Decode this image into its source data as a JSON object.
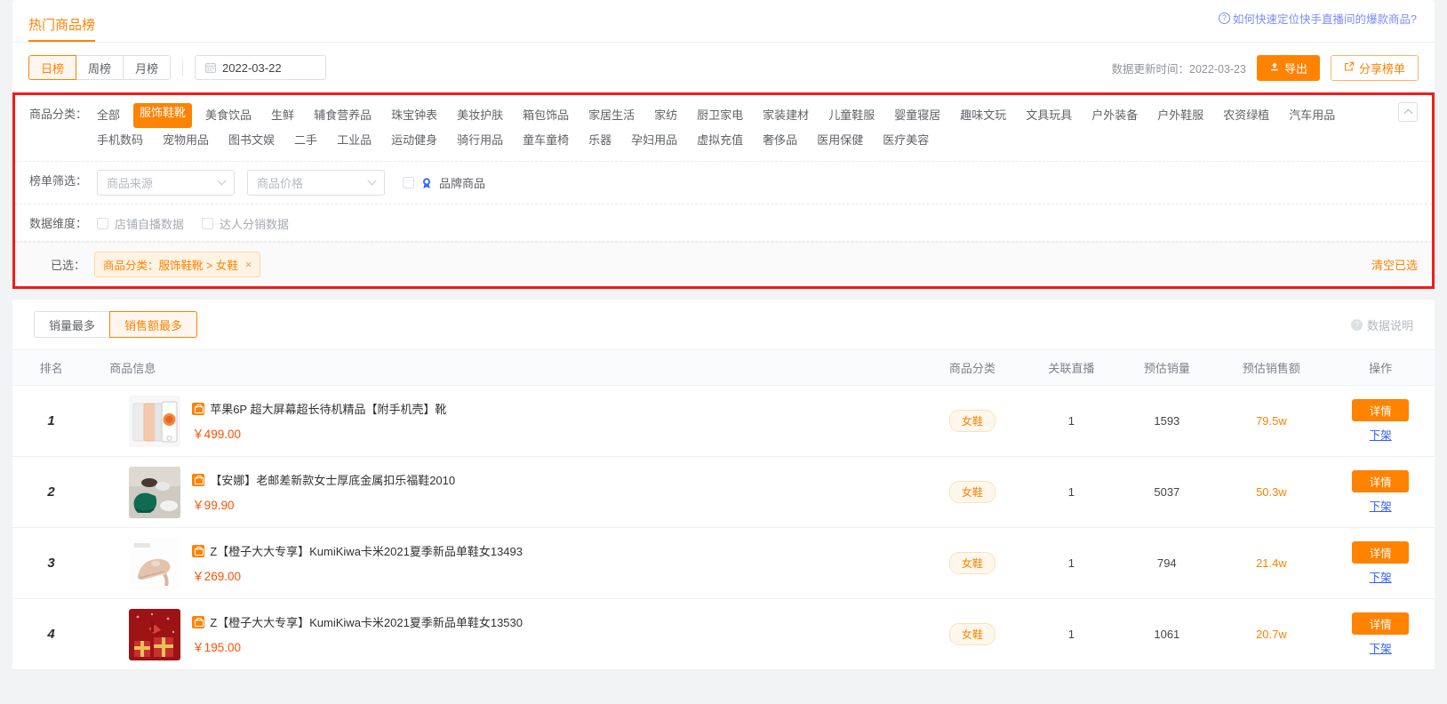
{
  "header": {
    "page_title": "热门商品榜",
    "help_link": "如何快速定位快手直播间的爆款商品?",
    "help_icon": "question-circle-icon"
  },
  "controls": {
    "period_tabs": [
      {
        "label": "日榜",
        "active": true
      },
      {
        "label": "周榜",
        "active": false
      },
      {
        "label": "月榜",
        "active": false
      }
    ],
    "date_value": "2022-03-22",
    "update_time_label": "数据更新时间：2022-03-23",
    "export_label": "导出",
    "share_label": "分享榜单"
  },
  "filters": {
    "category_label": "商品分类：",
    "categories": [
      {
        "label": "全部",
        "active": false
      },
      {
        "label": "服饰鞋靴",
        "active": true
      },
      {
        "label": "美食饮品",
        "active": false
      },
      {
        "label": "生鲜",
        "active": false
      },
      {
        "label": "辅食营养品",
        "active": false
      },
      {
        "label": "珠宝钟表",
        "active": false
      },
      {
        "label": "美妆护肤",
        "active": false
      },
      {
        "label": "箱包饰品",
        "active": false
      },
      {
        "label": "家居生活",
        "active": false
      },
      {
        "label": "家纺",
        "active": false
      },
      {
        "label": "厨卫家电",
        "active": false
      },
      {
        "label": "家装建材",
        "active": false
      },
      {
        "label": "儿童鞋服",
        "active": false
      },
      {
        "label": "婴童寝居",
        "active": false
      },
      {
        "label": "趣味文玩",
        "active": false
      },
      {
        "label": "文具玩具",
        "active": false
      },
      {
        "label": "户外装备",
        "active": false
      },
      {
        "label": "户外鞋服",
        "active": false
      },
      {
        "label": "农资绿植",
        "active": false
      },
      {
        "label": "汽车用品",
        "active": false
      },
      {
        "label": "手机数码",
        "active": false
      },
      {
        "label": "宠物用品",
        "active": false
      },
      {
        "label": "图书文娱",
        "active": false
      },
      {
        "label": "二手",
        "active": false
      },
      {
        "label": "工业品",
        "active": false
      },
      {
        "label": "运动健身",
        "active": false
      },
      {
        "label": "骑行用品",
        "active": false
      },
      {
        "label": "童车童椅",
        "active": false
      },
      {
        "label": "乐器",
        "active": false
      },
      {
        "label": "孕妇用品",
        "active": false
      },
      {
        "label": "虚拟充值",
        "active": false
      },
      {
        "label": "奢侈品",
        "active": false
      },
      {
        "label": "医用保健",
        "active": false
      },
      {
        "label": "医疗美容",
        "active": false
      }
    ],
    "collapse_icon": "chevron-up-icon",
    "list_filter_label": "榜单筛选：",
    "source_select_placeholder": "商品来源",
    "price_select_placeholder": "商品价格",
    "brand_checkbox_label": "品牌商品",
    "brand_icon": "brand-badge-icon",
    "dimension_label": "数据维度：",
    "dimension_options": [
      {
        "label": "店铺自播数据",
        "checked": false
      },
      {
        "label": "达人分销数据",
        "checked": false
      }
    ],
    "selected_label": "已选：",
    "selected_tag": "商品分类：服饰鞋靴 > 女鞋",
    "selected_tag_close": "×",
    "clear_label": "清空已选"
  },
  "table_panel": {
    "sort_tabs": [
      {
        "label": "销量最多",
        "active": false
      },
      {
        "label": "销售额最多",
        "active": true
      }
    ],
    "data_note_label": "数据说明",
    "data_note_icon": "question-circle-icon",
    "columns": [
      "排名",
      "商品信息",
      "商品分类",
      "关联直播",
      "预估销量",
      "预估销售额",
      "操作"
    ],
    "detail_label": "详情",
    "offshelf_label": "下架",
    "product_icon": "shop-bag-icon",
    "rows": [
      {
        "rank": "1",
        "name": "苹果6P 超大屏幕超长待机精品【附手机壳】靴",
        "price": "￥499.00",
        "category": "女鞋",
        "live": "1",
        "volume": "1593",
        "amount": "79.5w",
        "thumb": "phones"
      },
      {
        "rank": "2",
        "name": "【安娜】老邮差新款女士厚底金属扣乐福鞋2010",
        "price": "￥99.90",
        "category": "女鞋",
        "live": "1",
        "volume": "5037",
        "amount": "50.3w",
        "thumb": "greenshoe"
      },
      {
        "rank": "3",
        "name": "Z【橙子大大专享】KumiKiwa卡米2021夏季新品单鞋女13493",
        "price": "￥269.00",
        "category": "女鞋",
        "live": "1",
        "volume": "794",
        "amount": "21.4w",
        "thumb": "heel"
      },
      {
        "rank": "4",
        "name": "Z【橙子大大专享】KumiKiwa卡米2021夏季新品单鞋女13530",
        "price": "￥195.00",
        "category": "女鞋",
        "live": "1",
        "volume": "1061",
        "amount": "20.7w",
        "thumb": "redbox"
      }
    ]
  },
  "colors": {
    "accent": "#ff8200",
    "highlight_border": "#ef1c1c",
    "link": "#2e5bff",
    "price": "#ff5000"
  }
}
